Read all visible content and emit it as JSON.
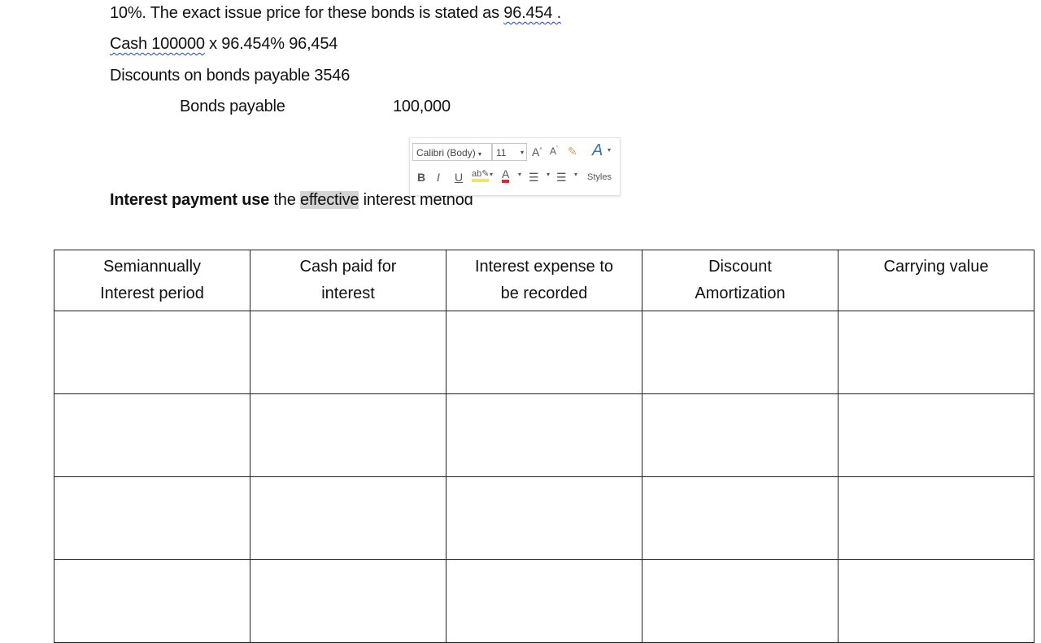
{
  "doc": {
    "line1_a": "10%. The exact issue price for these bonds is stated as ",
    "line1_b": "96.454 .",
    "line2_a": "Cash  100000",
    "line2_b": " x 96.454%     96,454",
    "line3": "Discounts on bonds payable 3546",
    "line4_a": "Bonds payable",
    "line4_b": "100,000",
    "heading_bold": "Interest payment use",
    "heading_a": " the ",
    "heading_sel": "effective",
    "heading_b": " interest method"
  },
  "mini_toolbar": {
    "font": "Calibri (Body)",
    "size": "11",
    "bold": "B",
    "italic": "I",
    "underline": "U",
    "styles": "Styles"
  },
  "table": {
    "headers": [
      [
        "Semiannually",
        "Interest period"
      ],
      [
        "Cash paid for",
        "interest"
      ],
      [
        "Interest expense to",
        "be recorded"
      ],
      [
        "Discount",
        "Amortization"
      ],
      [
        "Carrying value",
        ""
      ]
    ]
  }
}
